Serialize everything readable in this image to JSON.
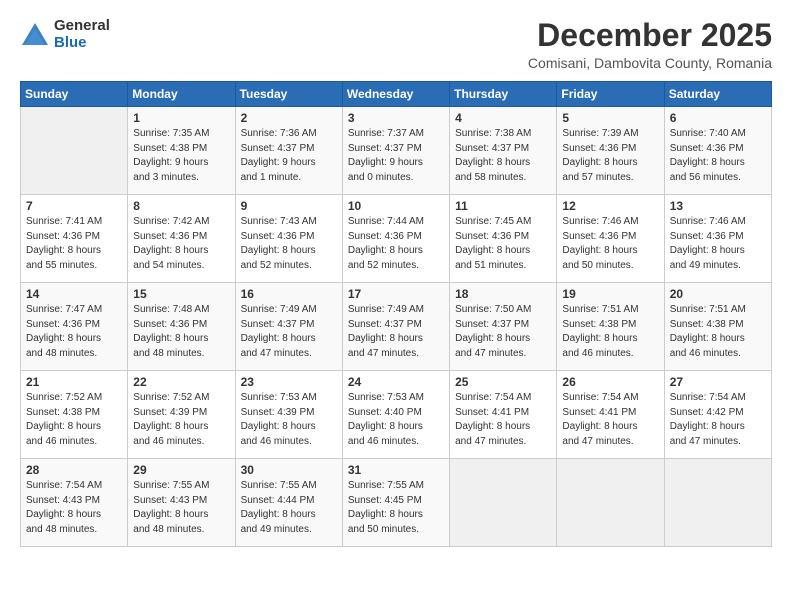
{
  "header": {
    "logo": {
      "general": "General",
      "blue": "Blue"
    },
    "title": "December 2025",
    "subtitle": "Comisani, Dambovita County, Romania"
  },
  "weekdays": [
    "Sunday",
    "Monday",
    "Tuesday",
    "Wednesday",
    "Thursday",
    "Friday",
    "Saturday"
  ],
  "weeks": [
    [
      {
        "day": "",
        "info": ""
      },
      {
        "day": "1",
        "info": "Sunrise: 7:35 AM\nSunset: 4:38 PM\nDaylight: 9 hours\nand 3 minutes."
      },
      {
        "day": "2",
        "info": "Sunrise: 7:36 AM\nSunset: 4:37 PM\nDaylight: 9 hours\nand 1 minute."
      },
      {
        "day": "3",
        "info": "Sunrise: 7:37 AM\nSunset: 4:37 PM\nDaylight: 9 hours\nand 0 minutes."
      },
      {
        "day": "4",
        "info": "Sunrise: 7:38 AM\nSunset: 4:37 PM\nDaylight: 8 hours\nand 58 minutes."
      },
      {
        "day": "5",
        "info": "Sunrise: 7:39 AM\nSunset: 4:36 PM\nDaylight: 8 hours\nand 57 minutes."
      },
      {
        "day": "6",
        "info": "Sunrise: 7:40 AM\nSunset: 4:36 PM\nDaylight: 8 hours\nand 56 minutes."
      }
    ],
    [
      {
        "day": "7",
        "info": "Sunrise: 7:41 AM\nSunset: 4:36 PM\nDaylight: 8 hours\nand 55 minutes."
      },
      {
        "day": "8",
        "info": "Sunrise: 7:42 AM\nSunset: 4:36 PM\nDaylight: 8 hours\nand 54 minutes."
      },
      {
        "day": "9",
        "info": "Sunrise: 7:43 AM\nSunset: 4:36 PM\nDaylight: 8 hours\nand 52 minutes."
      },
      {
        "day": "10",
        "info": "Sunrise: 7:44 AM\nSunset: 4:36 PM\nDaylight: 8 hours\nand 52 minutes."
      },
      {
        "day": "11",
        "info": "Sunrise: 7:45 AM\nSunset: 4:36 PM\nDaylight: 8 hours\nand 51 minutes."
      },
      {
        "day": "12",
        "info": "Sunrise: 7:46 AM\nSunset: 4:36 PM\nDaylight: 8 hours\nand 50 minutes."
      },
      {
        "day": "13",
        "info": "Sunrise: 7:46 AM\nSunset: 4:36 PM\nDaylight: 8 hours\nand 49 minutes."
      }
    ],
    [
      {
        "day": "14",
        "info": "Sunrise: 7:47 AM\nSunset: 4:36 PM\nDaylight: 8 hours\nand 48 minutes."
      },
      {
        "day": "15",
        "info": "Sunrise: 7:48 AM\nSunset: 4:36 PM\nDaylight: 8 hours\nand 48 minutes."
      },
      {
        "day": "16",
        "info": "Sunrise: 7:49 AM\nSunset: 4:37 PM\nDaylight: 8 hours\nand 47 minutes."
      },
      {
        "day": "17",
        "info": "Sunrise: 7:49 AM\nSunset: 4:37 PM\nDaylight: 8 hours\nand 47 minutes."
      },
      {
        "day": "18",
        "info": "Sunrise: 7:50 AM\nSunset: 4:37 PM\nDaylight: 8 hours\nand 47 minutes."
      },
      {
        "day": "19",
        "info": "Sunrise: 7:51 AM\nSunset: 4:38 PM\nDaylight: 8 hours\nand 46 minutes."
      },
      {
        "day": "20",
        "info": "Sunrise: 7:51 AM\nSunset: 4:38 PM\nDaylight: 8 hours\nand 46 minutes."
      }
    ],
    [
      {
        "day": "21",
        "info": "Sunrise: 7:52 AM\nSunset: 4:38 PM\nDaylight: 8 hours\nand 46 minutes."
      },
      {
        "day": "22",
        "info": "Sunrise: 7:52 AM\nSunset: 4:39 PM\nDaylight: 8 hours\nand 46 minutes."
      },
      {
        "day": "23",
        "info": "Sunrise: 7:53 AM\nSunset: 4:39 PM\nDaylight: 8 hours\nand 46 minutes."
      },
      {
        "day": "24",
        "info": "Sunrise: 7:53 AM\nSunset: 4:40 PM\nDaylight: 8 hours\nand 46 minutes."
      },
      {
        "day": "25",
        "info": "Sunrise: 7:54 AM\nSunset: 4:41 PM\nDaylight: 8 hours\nand 47 minutes."
      },
      {
        "day": "26",
        "info": "Sunrise: 7:54 AM\nSunset: 4:41 PM\nDaylight: 8 hours\nand 47 minutes."
      },
      {
        "day": "27",
        "info": "Sunrise: 7:54 AM\nSunset: 4:42 PM\nDaylight: 8 hours\nand 47 minutes."
      }
    ],
    [
      {
        "day": "28",
        "info": "Sunrise: 7:54 AM\nSunset: 4:43 PM\nDaylight: 8 hours\nand 48 minutes."
      },
      {
        "day": "29",
        "info": "Sunrise: 7:55 AM\nSunset: 4:43 PM\nDaylight: 8 hours\nand 48 minutes."
      },
      {
        "day": "30",
        "info": "Sunrise: 7:55 AM\nSunset: 4:44 PM\nDaylight: 8 hours\nand 49 minutes."
      },
      {
        "day": "31",
        "info": "Sunrise: 7:55 AM\nSunset: 4:45 PM\nDaylight: 8 hours\nand 50 minutes."
      },
      {
        "day": "",
        "info": ""
      },
      {
        "day": "",
        "info": ""
      },
      {
        "day": "",
        "info": ""
      }
    ]
  ]
}
